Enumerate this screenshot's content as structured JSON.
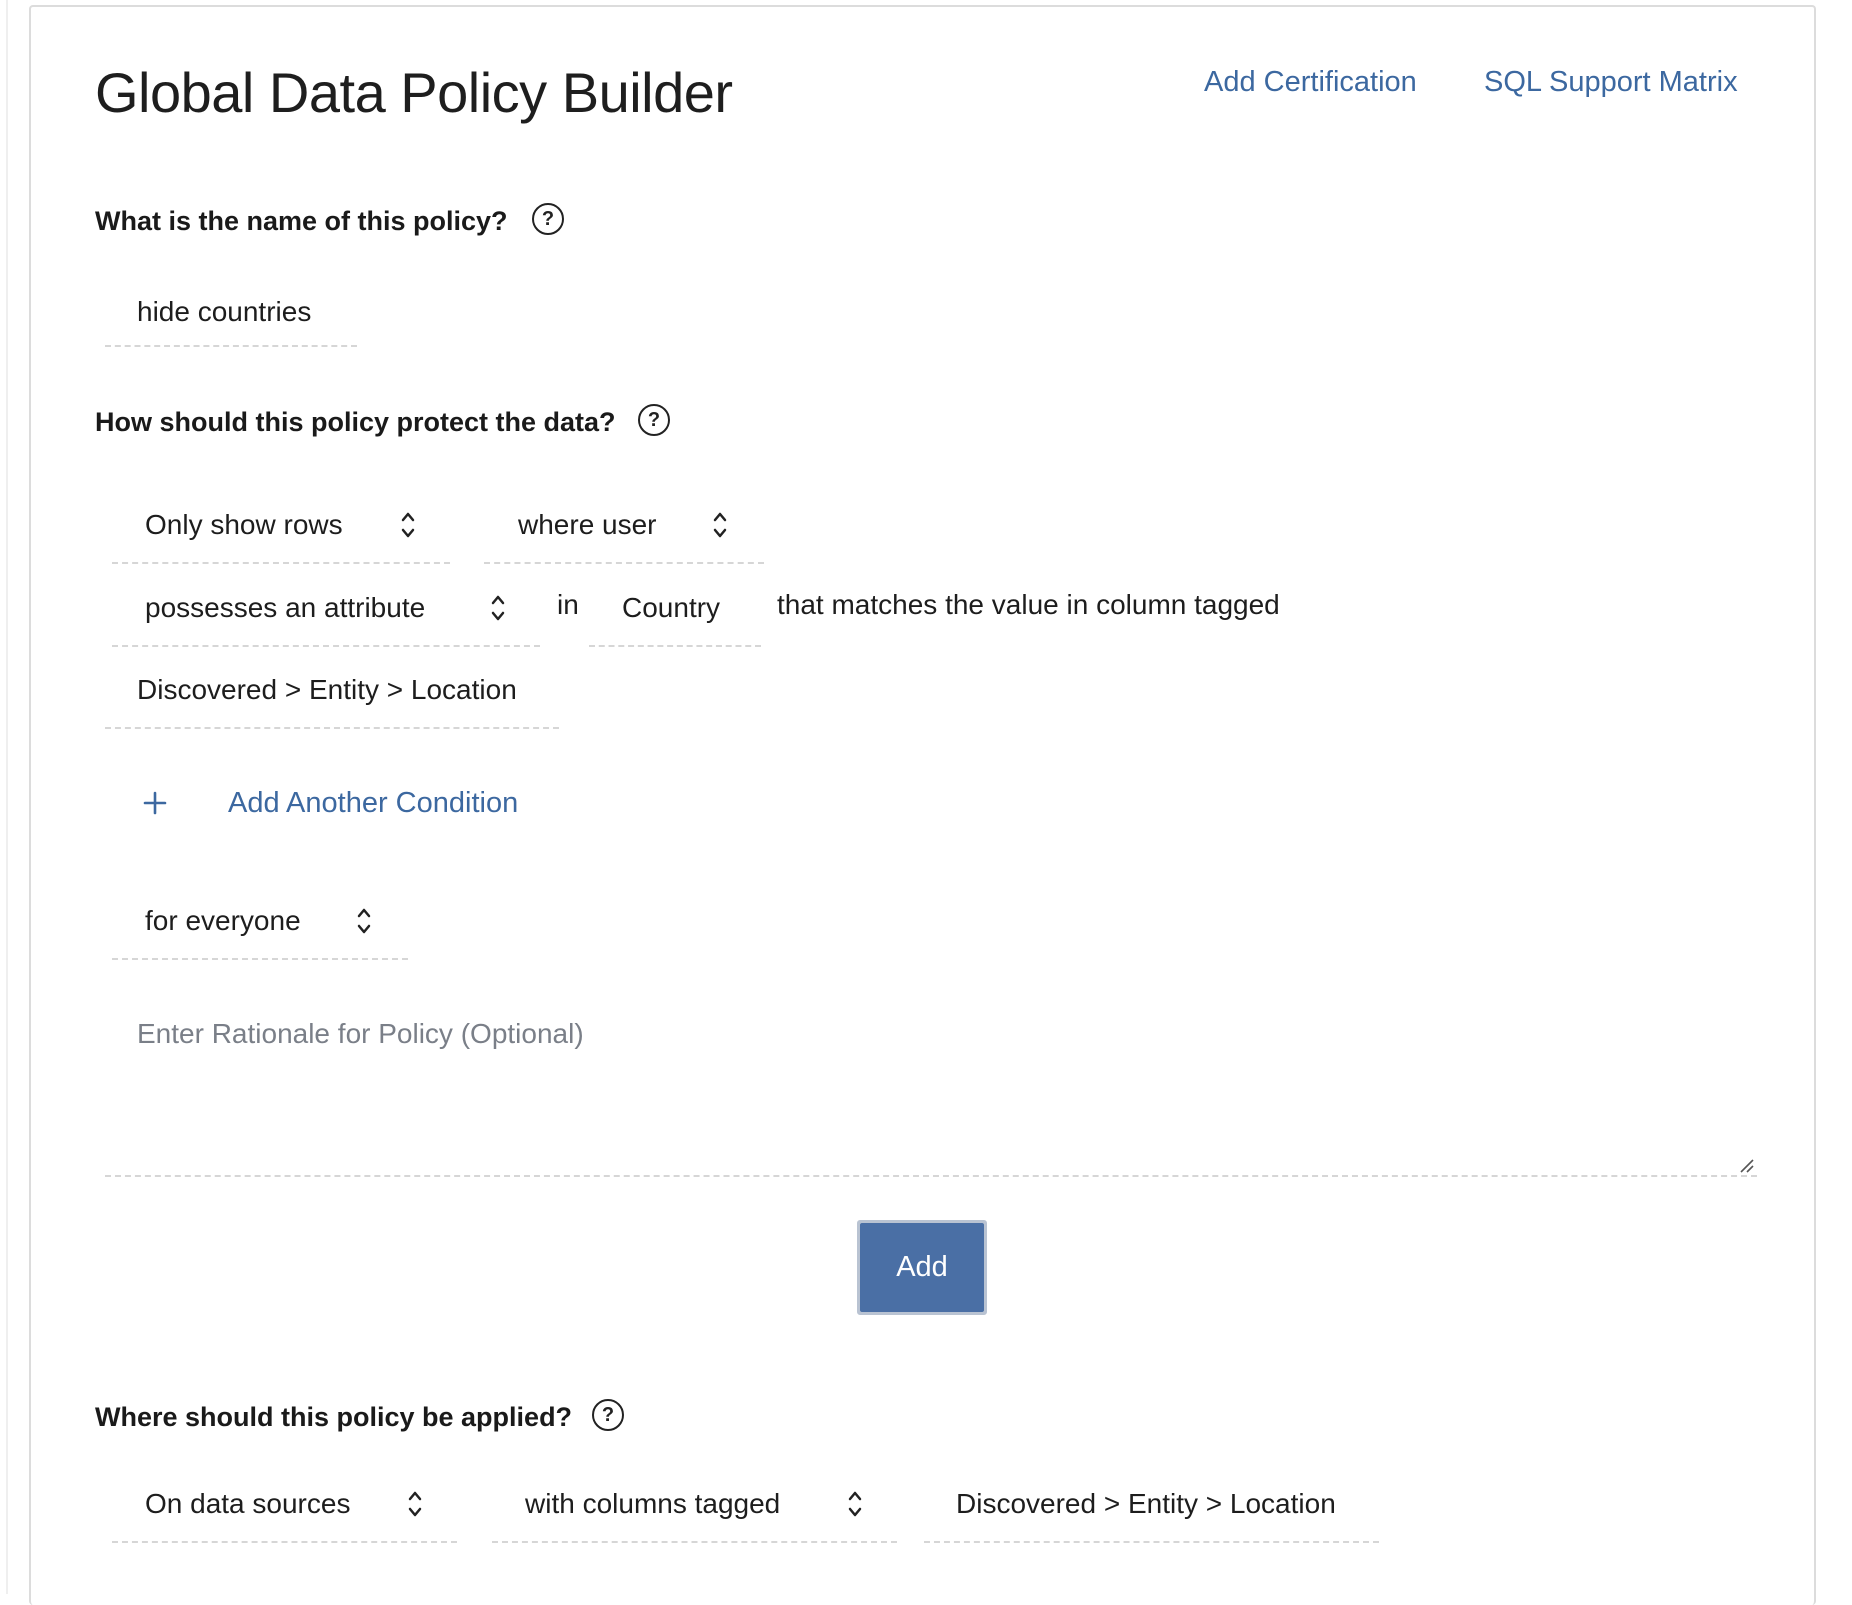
{
  "header": {
    "title": "Global Data Policy Builder",
    "links": {
      "add_certification": "Add Certification",
      "sql_support_matrix": "SQL Support Matrix"
    }
  },
  "name_section": {
    "question": "What is the name of this policy?",
    "help_icon": "question-circle-icon",
    "policy_name_value": "hide countries"
  },
  "protect_section": {
    "question": "How should this policy protect the data?",
    "help_icon": "question-circle-icon",
    "action_select": "Only show rows",
    "where_select": "where user",
    "condition_select": "possesses an attribute",
    "in_text": "in",
    "attribute_value": "Country",
    "matches_text": "that matches the value in column tagged",
    "tag_value": "Discovered > Entity > Location",
    "add_condition": {
      "icon": "plus-icon",
      "label": "Add Another Condition"
    },
    "audience_select": "for everyone",
    "rationale_placeholder": "Enter Rationale for Policy (Optional)",
    "add_button": "Add"
  },
  "apply_section": {
    "question": "Where should this policy be applied?",
    "help_icon": "question-circle-icon",
    "source_select": "On data sources",
    "column_select": "with columns tagged",
    "tag_value": "Discovered > Entity > Location"
  },
  "colors": {
    "link": "#3c68a0",
    "button": "#4a6fa5",
    "placeholder": "#7a7f88",
    "dashed_border": "#d6d6d6"
  }
}
